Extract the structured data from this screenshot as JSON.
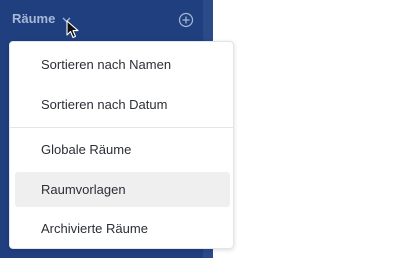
{
  "sidebar": {
    "title": "Räume",
    "dropdown_icon": "chevron-down-icon",
    "add_icon": "plus-circle-icon"
  },
  "menu": {
    "sort_items": [
      {
        "label": "Sortieren nach Namen"
      },
      {
        "label": "Sortieren nach Datum"
      }
    ],
    "room_items": [
      {
        "label": "Globale Räume"
      },
      {
        "label": "Raumvorlagen",
        "highlighted": true
      },
      {
        "label": "Archivierte Räume"
      }
    ]
  },
  "colors": {
    "sidebar_bg": "#1f3f7f",
    "sidebar_title": "#a8b8d8",
    "menu_hover_bg": "#efefef",
    "menu_text": "#2b2f36"
  }
}
